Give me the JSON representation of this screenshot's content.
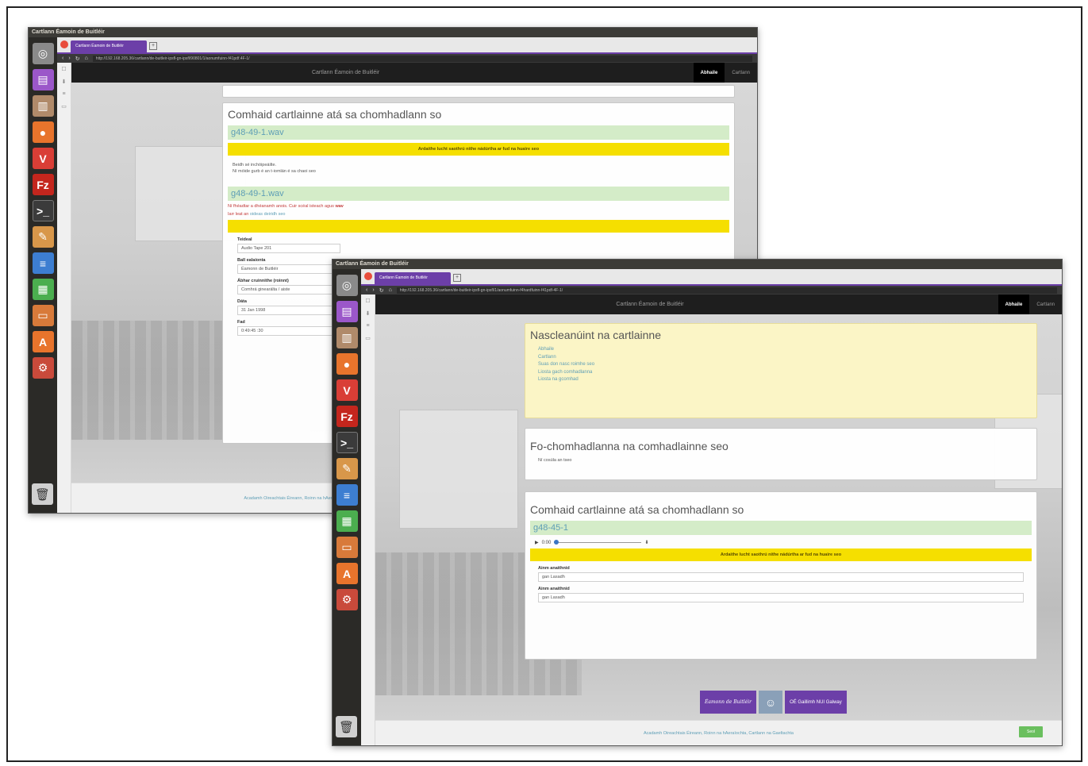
{
  "window_a": {
    "os_title": "Cartlann Éamoin de Buitléir",
    "tab_label": "Cartlann Éamoin de Buitléir",
    "url": "http://192.168.205.36/cartlann/de-buitleir-ipsfl-gn-ipsfl/90801/1/aonumfuinn-f41pdf.4F-1/",
    "site_brand": "Cartlann Éamoin de Buitléir",
    "nav_items": [
      "Abhaile",
      "Cartlann"
    ],
    "card_title": "Comhaid cartlainne atá sa chomhadlann so",
    "file1_name": "g48-49-1.wav",
    "warning": "Ardaithe lucht saothrú nithe nádúrtha ar fud na huaire seo",
    "file1_lines": [
      "Beidh sé inchóipeáilte.",
      "Ní móide gurb é an t-iomlán é sa chaoi seo"
    ],
    "file2_name": "g48-49-1.wav",
    "red_line_text": "Ní fhéadtar a dhéanamh anois. Cuir scéal isteach agus",
    "red_line_link": "wav",
    "ask_prefix": "Iarr leat an",
    "ask_link": "oideas deiridh seo",
    "fields": [
      {
        "label": "Teideal",
        "value": "Audio Tape 201"
      },
      {
        "label": "Ball ealaíonta",
        "value": "Éamonn de Buitléir"
      },
      {
        "label": "Ábhar cruinnithe (roinnt)",
        "value": "Comhrá ginearálta / aiste"
      },
      {
        "label": "Dáta",
        "value": "31 Jan 1998"
      },
      {
        "label": "Fad",
        "value": "0:49:45 :30"
      }
    ],
    "footer_link": "Acadamh Oireachtais Éireann, Roinn na hAeraíochta"
  },
  "window_b": {
    "os_title": "Cartlann Éamoin de Buitléir",
    "tab_label": "Cartlann Éamoin de Buitléir",
    "url": "http://192.168.205.36/cartlann/de-buitleir-ipsfl-gn-ipsfl/1/aonumfuinn-f4hardfuinn-f41pdf-4F-1/",
    "site_brand": "Cartlann Éamoin de Buitléir",
    "nav_items": [
      "Abhaile",
      "Cartlann"
    ],
    "links_title": "Nascleanúint na cartlainne",
    "links": [
      "Abhaile",
      "Cartlann",
      "Suas don nasc roimhe seo",
      "Liosta gach comhadlanna",
      "Liosta na gcomhad"
    ],
    "subfolders_title": "Fo-chomhadlanna na comhadlainne seo",
    "subfolders_note": "Ní cosúla an tseo",
    "files_title": "Comhaid cartlainne atá sa chomhadlann so",
    "file_name": "g48-45-1",
    "audio_time": "0:00",
    "warning": "Ardaithe lucht saothrú nithe nádúrtha ar fud na huaire seo",
    "fields": [
      {
        "label": "Ainm anaithnid",
        "value": "gan Lasadh"
      },
      {
        "label": "Ainm anaithnid",
        "value": "gan Lasadh"
      }
    ],
    "sponsor_logo": "Éamonn de Buitléir",
    "sponsor_text": "OÉ Gaillimh NUI Galway",
    "footer_link": "Acadamh Oireachtais Éireann, Roinn na hAeraíochta, Cartlann na Gaeltachta",
    "submit_label": "Seol"
  },
  "colors": {
    "accent": "#6c3fa8",
    "warning": "#f5df00",
    "file_bar": "#d4ecc8",
    "links_bg": "#fbf5c6"
  },
  "launcher_icons": [
    "dash-icon",
    "files-icon",
    "firefox-icon",
    "vivaldi-icon",
    "filezilla-icon",
    "terminal-icon",
    "text-editor-icon",
    "document-icon",
    "spreadsheet-icon",
    "presentation-icon",
    "software-center-icon",
    "settings-icon",
    "trash-icon"
  ]
}
